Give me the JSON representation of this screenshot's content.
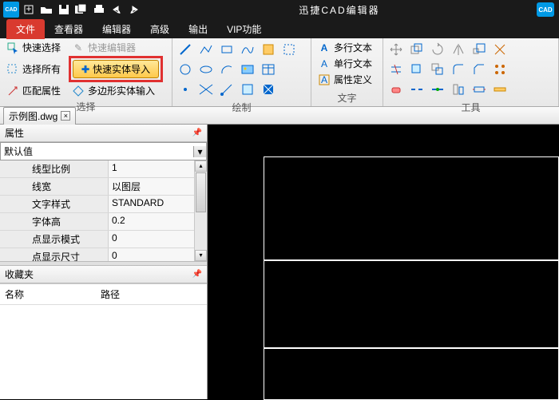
{
  "app": {
    "title": "迅捷CAD编辑器",
    "logo_text": "CAD"
  },
  "menu": {
    "file": "文件",
    "viewer": "查看器",
    "editor": "编辑器",
    "advanced": "高级",
    "output": "输出",
    "vip": "VIP功能"
  },
  "ribbon": {
    "select_group": {
      "quick_select": "快速选择",
      "select_all": "选择所有",
      "match_props": "匹配属性",
      "quick_editor": "快速编辑器",
      "highlighted": "快速实体导入",
      "polygon_input": "多边形实体输入",
      "label": "选择"
    },
    "draw_group": {
      "label": "绘制"
    },
    "text_group": {
      "mtext": "多行文本",
      "stext": "单行文本",
      "attdef": "属性定义",
      "label": "文字"
    },
    "tools_group": {
      "label": "工具"
    }
  },
  "doc_tab": "示例图.dwg",
  "properties": {
    "title": "属性",
    "default": "默认值",
    "rows": [
      {
        "k": "线型比例",
        "v": "1"
      },
      {
        "k": "线宽",
        "v": "以图层"
      },
      {
        "k": "文字样式",
        "v": "STANDARD"
      },
      {
        "k": "字体高",
        "v": "0.2"
      },
      {
        "k": "点显示模式",
        "v": "0"
      },
      {
        "k": "点显示尺寸",
        "v": "0"
      }
    ]
  },
  "favorites": {
    "title": "收藏夹",
    "col_name": "名称",
    "col_path": "路径"
  }
}
